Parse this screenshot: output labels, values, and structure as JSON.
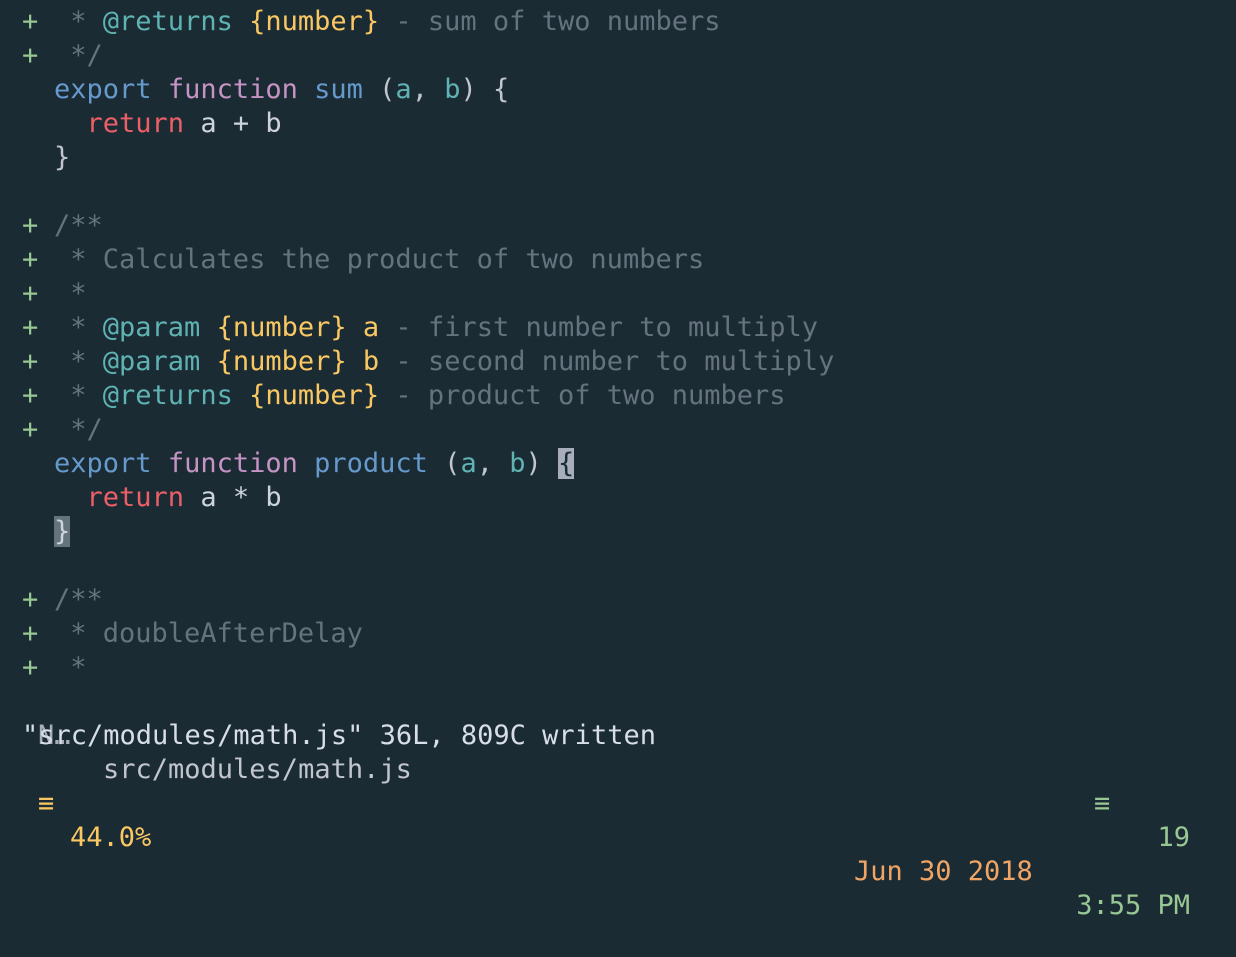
{
  "editor": {
    "lines": [
      {
        "marker": "+",
        "parts": [
          {
            "cls": "t-comment",
            "text": " * "
          },
          {
            "cls": "t-tag",
            "text": "@returns"
          },
          {
            "cls": "t-plain",
            "text": " "
          },
          {
            "cls": "t-type",
            "text": "{number}"
          },
          {
            "cls": "t-comment",
            "text": " - sum of two numbers"
          }
        ]
      },
      {
        "marker": "+",
        "parts": [
          {
            "cls": "t-comment",
            "text": " */"
          }
        ]
      },
      {
        "marker": "",
        "parts": [
          {
            "cls": "t-export",
            "text": "export"
          },
          {
            "cls": "t-plain",
            "text": " "
          },
          {
            "cls": "t-function",
            "text": "function"
          },
          {
            "cls": "t-plain",
            "text": " "
          },
          {
            "cls": "t-name",
            "text": "sum"
          },
          {
            "cls": "t-punct",
            "text": " ("
          },
          {
            "cls": "t-arg",
            "text": "a"
          },
          {
            "cls": "t-punct",
            "text": ", "
          },
          {
            "cls": "t-arg",
            "text": "b"
          },
          {
            "cls": "t-punct",
            "text": ") {"
          }
        ]
      },
      {
        "marker": "",
        "parts": [
          {
            "cls": "t-plain",
            "text": "  "
          },
          {
            "cls": "t-return",
            "text": "return"
          },
          {
            "cls": "t-plain",
            "text": " a + b"
          }
        ]
      },
      {
        "marker": "",
        "parts": [
          {
            "cls": "t-punct",
            "text": "}"
          }
        ]
      },
      {
        "marker": "",
        "parts": []
      },
      {
        "marker": "+",
        "parts": [
          {
            "cls": "t-comment",
            "text": "/**"
          }
        ]
      },
      {
        "marker": "+",
        "parts": [
          {
            "cls": "t-comment",
            "text": " * Calculates the product of two numbers"
          }
        ]
      },
      {
        "marker": "+",
        "parts": [
          {
            "cls": "t-comment",
            "text": " *"
          }
        ]
      },
      {
        "marker": "+",
        "parts": [
          {
            "cls": "t-comment",
            "text": " * "
          },
          {
            "cls": "t-tag",
            "text": "@param"
          },
          {
            "cls": "t-plain",
            "text": " "
          },
          {
            "cls": "t-type",
            "text": "{number}"
          },
          {
            "cls": "t-plain",
            "text": " "
          },
          {
            "cls": "t-param",
            "text": "a"
          },
          {
            "cls": "t-comment",
            "text": " - first number to multiply"
          }
        ]
      },
      {
        "marker": "+",
        "parts": [
          {
            "cls": "t-comment",
            "text": " * "
          },
          {
            "cls": "t-tag",
            "text": "@param"
          },
          {
            "cls": "t-plain",
            "text": " "
          },
          {
            "cls": "t-type",
            "text": "{number}"
          },
          {
            "cls": "t-plain",
            "text": " "
          },
          {
            "cls": "t-param",
            "text": "b"
          },
          {
            "cls": "t-comment",
            "text": " - second number to multiply"
          }
        ]
      },
      {
        "marker": "+",
        "parts": [
          {
            "cls": "t-comment",
            "text": " * "
          },
          {
            "cls": "t-tag",
            "text": "@returns"
          },
          {
            "cls": "t-plain",
            "text": " "
          },
          {
            "cls": "t-type",
            "text": "{number}"
          },
          {
            "cls": "t-comment",
            "text": " - product of two numbers"
          }
        ]
      },
      {
        "marker": "+",
        "parts": [
          {
            "cls": "t-comment",
            "text": " */"
          }
        ]
      },
      {
        "marker": "",
        "parts": [
          {
            "cls": "t-export",
            "text": "export"
          },
          {
            "cls": "t-plain",
            "text": " "
          },
          {
            "cls": "t-function",
            "text": "function"
          },
          {
            "cls": "t-plain",
            "text": " "
          },
          {
            "cls": "t-name",
            "text": "product"
          },
          {
            "cls": "t-punct",
            "text": " ("
          },
          {
            "cls": "t-arg",
            "text": "a"
          },
          {
            "cls": "t-punct",
            "text": ", "
          },
          {
            "cls": "t-arg",
            "text": "b"
          },
          {
            "cls": "t-punct",
            "text": ") "
          },
          {
            "cls": "cursor-block",
            "text": "{"
          }
        ]
      },
      {
        "marker": "",
        "parts": [
          {
            "cls": "t-plain",
            "text": "  "
          },
          {
            "cls": "t-return",
            "text": "return"
          },
          {
            "cls": "t-plain",
            "text": " a * b"
          }
        ]
      },
      {
        "marker": "",
        "parts": [
          {
            "cls": "match-block",
            "text": "}"
          }
        ]
      },
      {
        "marker": "",
        "parts": []
      },
      {
        "marker": "+",
        "parts": [
          {
            "cls": "t-comment",
            "text": "/**"
          }
        ]
      },
      {
        "marker": "+",
        "parts": [
          {
            "cls": "t-comment",
            "text": " * doubleAfterDelay"
          }
        ]
      },
      {
        "marker": "+",
        "parts": [
          {
            "cls": "t-comment",
            "text": " *"
          }
        ]
      }
    ]
  },
  "statusline": {
    "mode": "N…",
    "filepath": "src/modules/math.js",
    "icon": "≡",
    "line_number": "19"
  },
  "message": "\"src/modules/math.js\" 36L, 809C written",
  "bottombar": {
    "icon": "≡",
    "percent": "44.0%",
    "date": "Jun 30 2018",
    "time": "3:55 PM"
  }
}
